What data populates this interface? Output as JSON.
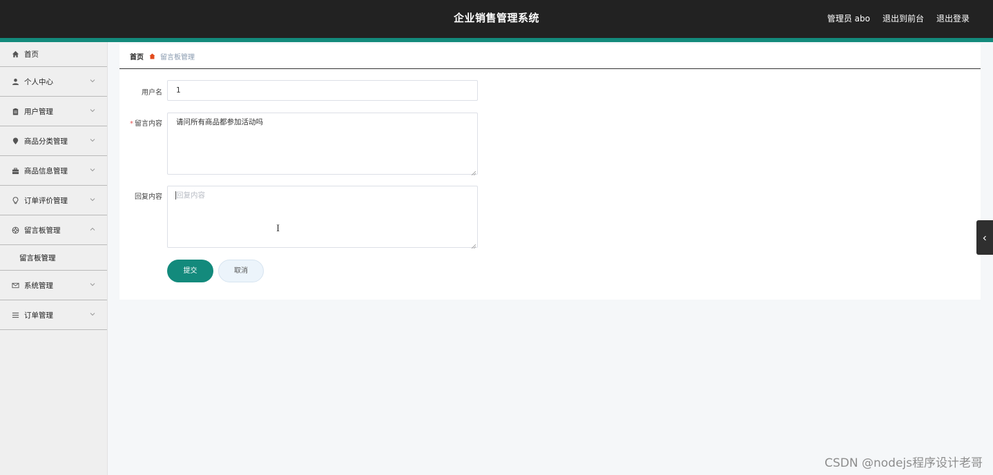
{
  "header": {
    "app_title": "企业销售管理系统",
    "user_label": "管理员 abo",
    "to_front_label": "退出到前台",
    "logout_label": "退出登录"
  },
  "sidebar": {
    "items": [
      {
        "label": "首页",
        "icon": "home-icon"
      },
      {
        "label": "个人中心",
        "icon": "user-icon"
      },
      {
        "label": "用户管理",
        "icon": "clipboard-icon"
      },
      {
        "label": "商品分类管理",
        "icon": "pin-icon"
      },
      {
        "label": "商品信息管理",
        "icon": "briefcase-icon"
      },
      {
        "label": "订单评价管理",
        "icon": "lightbulb-icon"
      },
      {
        "label": "留言板管理",
        "icon": "lifebuoy-icon",
        "expanded": true,
        "children": [
          "留言板管理"
        ]
      },
      {
        "label": "系统管理",
        "icon": "mail-icon"
      },
      {
        "label": "订单管理",
        "icon": "menu-icon"
      }
    ]
  },
  "breadcrumb": {
    "home": "首页",
    "current": "留言板管理"
  },
  "form": {
    "username_label": "用户名",
    "username_value": "1",
    "content_required_mark": "*",
    "content_label": "留言内容",
    "content_value": "请问所有商品都参加活动吗",
    "reply_label": "回复内容",
    "reply_placeholder": "回复内容",
    "submit_label": "提交",
    "cancel_label": "取消"
  },
  "watermark": "CSDN @nodejs程序设计老哥",
  "colors": {
    "accent": "#138a7c",
    "header_bg": "#222222",
    "required": "#e45656"
  }
}
